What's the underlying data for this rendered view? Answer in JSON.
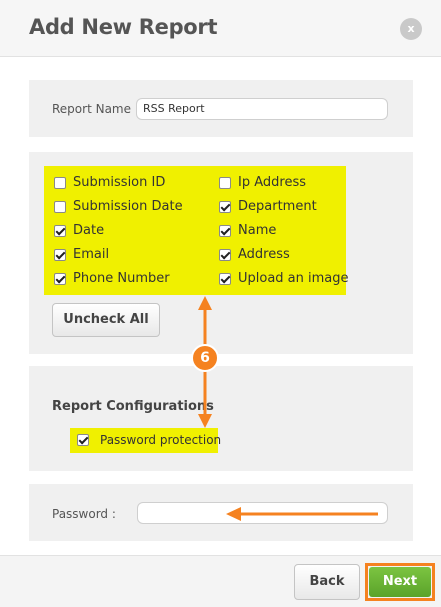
{
  "header": {
    "title": "Add New Report",
    "close_label": "x"
  },
  "report_name": {
    "label": "Report Name :",
    "value": "RSS Report"
  },
  "fields": {
    "left": [
      {
        "label": "Submission ID",
        "checked": false
      },
      {
        "label": "Submission Date",
        "checked": false
      },
      {
        "label": "Date",
        "checked": true
      },
      {
        "label": "Email",
        "checked": true
      },
      {
        "label": "Phone Number",
        "checked": true
      }
    ],
    "right": [
      {
        "label": "Ip Address",
        "checked": false
      },
      {
        "label": "Department",
        "checked": true
      },
      {
        "label": "Name",
        "checked": true
      },
      {
        "label": "Address",
        "checked": true
      },
      {
        "label": "Upload an image",
        "checked": true
      }
    ],
    "uncheck_all_label": "Uncheck All"
  },
  "config": {
    "title": "Report Configurations",
    "password_protection": {
      "label": "Password protection",
      "checked": true
    }
  },
  "password": {
    "label": "Password :",
    "value": ""
  },
  "footer": {
    "back_label": "Back",
    "next_label": "Next"
  },
  "annotation": {
    "step_number": "6"
  },
  "colors": {
    "highlight": "#f0f000",
    "annotation": "#f58220",
    "next_button": "#6bb536"
  }
}
